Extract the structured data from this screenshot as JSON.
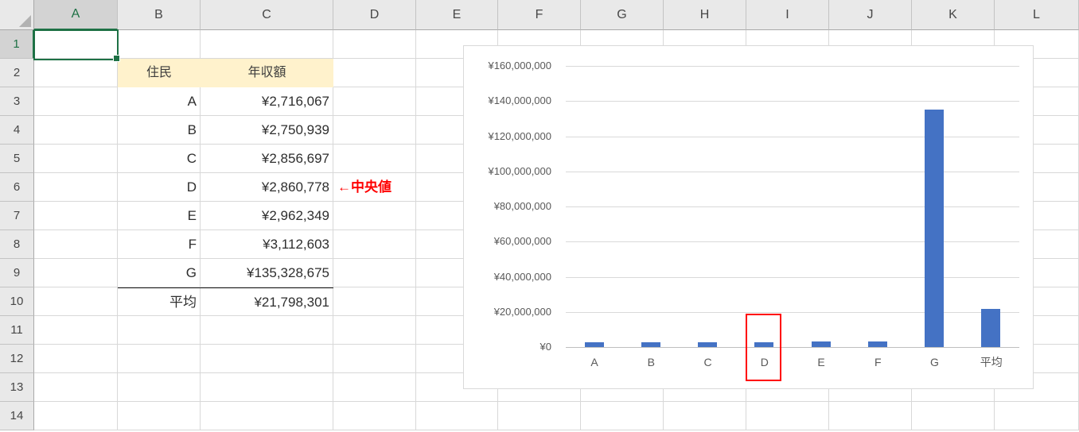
{
  "colors": {
    "accent_green": "#1E7145",
    "bar_blue": "#4472C4",
    "highlight_red": "#FF0000",
    "table_header_fill": "#FFF2CC"
  },
  "spreadsheet": {
    "selected_cell": "A1",
    "column_headers": [
      "A",
      "B",
      "C",
      "D",
      "E",
      "F",
      "G",
      "H",
      "I",
      "J",
      "K",
      "L"
    ],
    "row_headers": [
      "1",
      "2",
      "3",
      "4",
      "5",
      "6",
      "7",
      "8",
      "9",
      "10",
      "11",
      "12",
      "13",
      "14"
    ],
    "table": {
      "headers": {
        "resident": "住民",
        "income": "年収額"
      },
      "rows": [
        {
          "resident": "A",
          "income": "¥2,716,067"
        },
        {
          "resident": "B",
          "income": "¥2,750,939"
        },
        {
          "resident": "C",
          "income": "¥2,856,697"
        },
        {
          "resident": "D",
          "income": "¥2,860,778"
        },
        {
          "resident": "E",
          "income": "¥2,962,349"
        },
        {
          "resident": "F",
          "income": "¥3,112,603"
        },
        {
          "resident": "G",
          "income": "¥135,328,675"
        },
        {
          "resident": "平均",
          "income": "¥21,798,301"
        }
      ],
      "median_annotation": "←中央値",
      "median_annotation_row": "D"
    }
  },
  "chart_data": {
    "type": "bar",
    "title": "",
    "xlabel": "",
    "ylabel": "",
    "categories": [
      "A",
      "B",
      "C",
      "D",
      "E",
      "F",
      "G",
      "平均"
    ],
    "values": [
      2716067,
      2750939,
      2856697,
      2860778,
      2962349,
      3112603,
      135328675,
      21798301
    ],
    "ylim": [
      0,
      160000000
    ],
    "y_tick_step": 20000000,
    "y_tick_labels_top_to_bottom": [
      "¥160,000,000",
      "¥140,000,000",
      "¥120,000,000",
      "¥100,000,000",
      "¥80,000,000",
      "¥60,000,000",
      "¥40,000,000",
      "¥20,000,000",
      "¥0"
    ],
    "grid": true,
    "legend": false,
    "bar_color": "#4472C4",
    "highlighted_category": "D",
    "highlight_box_color": "#FF0000"
  }
}
